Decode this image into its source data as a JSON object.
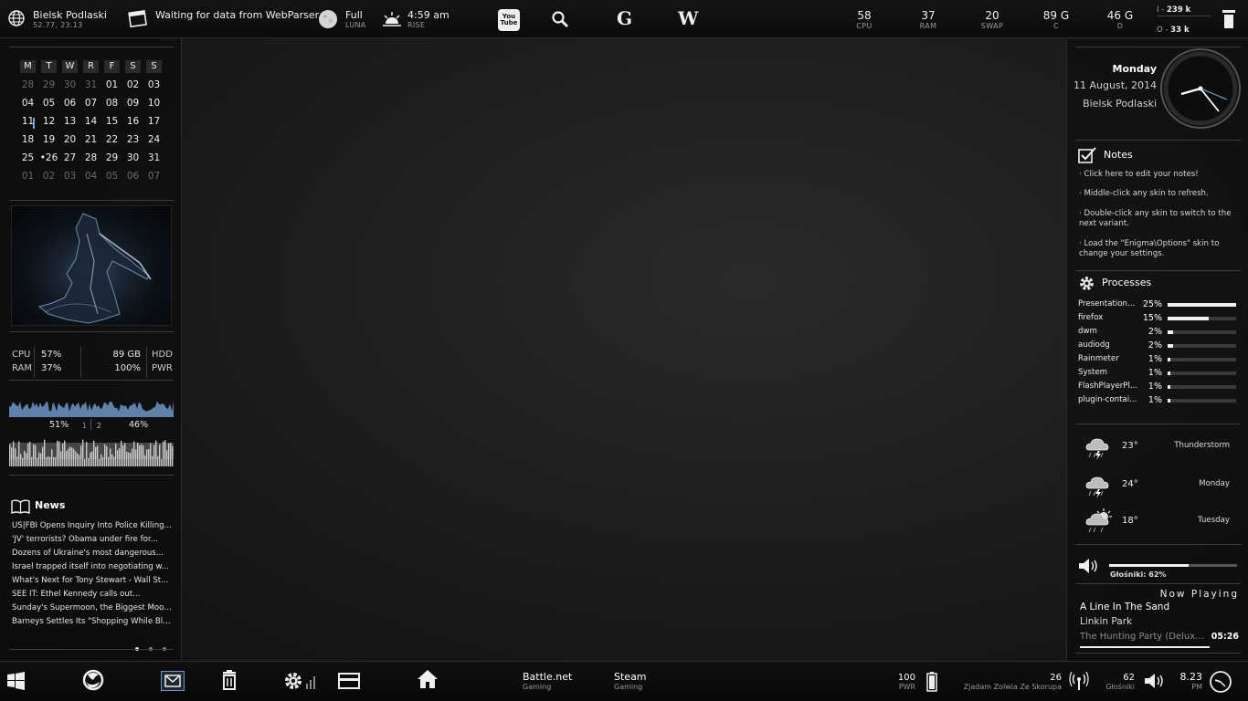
{
  "topbar": {
    "location": {
      "name": "Bielsk Podlaski",
      "coords": "52.77, 23.13"
    },
    "webparser": "Waiting for data from WebParser.",
    "moon": {
      "phase": "Full",
      "label": "LUNA"
    },
    "sunrise": {
      "time": "4:59 am",
      "label": "RISE"
    },
    "links": {
      "youtube": "You Tube",
      "google": "G",
      "wikipedia": "W"
    },
    "stats": [
      {
        "value": "58",
        "label": "CPU"
      },
      {
        "value": "37",
        "label": "RAM"
      },
      {
        "value": "20",
        "label": "SWAP"
      },
      {
        "value": "89 G",
        "label": "C"
      },
      {
        "value": "46 G",
        "label": "D"
      }
    ],
    "net": {
      "in": "239 k",
      "in_prefix": "I -",
      "out": "33 k",
      "out_prefix": "O -"
    }
  },
  "calendar": {
    "headers": [
      "M",
      "T",
      "W",
      "R",
      "F",
      "S",
      "S"
    ],
    "weeks": [
      [
        {
          "d": "28",
          "dim": true
        },
        {
          "d": "29",
          "dim": true
        },
        {
          "d": "30",
          "dim": true
        },
        {
          "d": "31",
          "dim": true
        },
        {
          "d": "01"
        },
        {
          "d": "02"
        },
        {
          "d": "03"
        }
      ],
      [
        {
          "d": "04"
        },
        {
          "d": "05"
        },
        {
          "d": "06"
        },
        {
          "d": "07"
        },
        {
          "d": "08"
        },
        {
          "d": "09"
        },
        {
          "d": "10"
        }
      ],
      [
        {
          "d": "11",
          "today": true
        },
        {
          "d": "12"
        },
        {
          "d": "13"
        },
        {
          "d": "14"
        },
        {
          "d": "15"
        },
        {
          "d": "16"
        },
        {
          "d": "17"
        }
      ],
      [
        {
          "d": "18"
        },
        {
          "d": "19"
        },
        {
          "d": "20"
        },
        {
          "d": "21"
        },
        {
          "d": "22"
        },
        {
          "d": "23"
        },
        {
          "d": "24"
        }
      ],
      [
        {
          "d": "25"
        },
        {
          "d": "•26"
        },
        {
          "d": "27"
        },
        {
          "d": "28"
        },
        {
          "d": "29"
        },
        {
          "d": "30"
        },
        {
          "d": "31"
        }
      ],
      [
        {
          "d": "01",
          "dim": true
        },
        {
          "d": "02",
          "dim": true
        },
        {
          "d": "03",
          "dim": true
        },
        {
          "d": "04",
          "dim": true
        },
        {
          "d": "05",
          "dim": true
        },
        {
          "d": "06",
          "dim": true
        },
        {
          "d": "07",
          "dim": true
        }
      ]
    ]
  },
  "system": {
    "cpu_label": "CPU",
    "cpu_value": "57%",
    "ram_label": "RAM",
    "ram_value": "37%",
    "hdd_value": "89 GB",
    "hdd_label": "HDD",
    "pwr_value": "100%",
    "pwr_label": "PWR"
  },
  "graphs": {
    "left_pct": "51%",
    "left_num": "1",
    "right_num": "2",
    "right_pct": "46%"
  },
  "news": {
    "title": "News",
    "items": [
      "US|FBI Opens Inquiry Into Police Killing...",
      "'JV' terrorists? Obama under fire for...",
      "Dozens of Ukraine's most dangerous...",
      "Israel trapped itself into negotiating w...",
      "What's Next for Tony Stewart - Wall St...",
      "SEE IT: Ethel Kennedy calls out...",
      "Sunday's Supermoon, the Biggest Moon...",
      "Barneys Settles Its \"Shopping While Bla..."
    ]
  },
  "clock": {
    "day": "Monday",
    "date": "11 August, 2014",
    "city": "Bielsk Podlaski"
  },
  "notes": {
    "title": "Notes",
    "items": [
      "· Click here to edit your notes!",
      "· Middle-click any skin to refresh.",
      "· Double-click any skin to switch to the next variant.",
      "· Load the \"Enigma\\Options\" skin to change your settings."
    ]
  },
  "processes": {
    "title": "Processes",
    "items": [
      {
        "name": "Presentation...",
        "pct": "25%",
        "level": 1.0
      },
      {
        "name": "firefox",
        "pct": "15%",
        "level": 0.6
      },
      {
        "name": "dwm",
        "pct": "2%",
        "level": 0.08
      },
      {
        "name": "audiodg",
        "pct": "2%",
        "level": 0.08
      },
      {
        "name": "Rainmeter",
        "pct": "1%",
        "level": 0.04
      },
      {
        "name": "System",
        "pct": "1%",
        "level": 0.04
      },
      {
        "name": "FlashPlayerPl...",
        "pct": "1%",
        "level": 0.04
      },
      {
        "name": "plugin-contai...",
        "pct": "1%",
        "level": 0.04
      }
    ]
  },
  "weather": [
    {
      "temp": "23°",
      "desc": "Thunderstorm"
    },
    {
      "temp": "24°",
      "desc": "Monday"
    },
    {
      "temp": "18°",
      "desc": "Tuesday"
    }
  ],
  "volume": {
    "label": "Głośniki: 62%",
    "level": 0.62
  },
  "nowplaying": {
    "header": "Now Playing",
    "track": "A Line In The Sand",
    "artist": "Linkin Park",
    "album": "The Hunting Party (Deluxe...",
    "time": "05:26"
  },
  "taskbar": {
    "launchers": [
      {
        "title": "Battle.net",
        "sub": "Gaming"
      },
      {
        "title": "Steam",
        "sub": "Gaming"
      }
    ],
    "power": {
      "value": "100",
      "label": "PWR"
    },
    "wifi": {
      "value": "26",
      "label": "Zjadam Zolwia Ze Skorupa"
    },
    "speaker": {
      "value": "62",
      "label": "Głośniki"
    },
    "clock": {
      "time": "8.23",
      "ampm": "PM"
    }
  },
  "colors": {
    "accent": "#7aa7d8",
    "graph_fill": "#6f95c6",
    "graph_fill2": "#c9c9c9"
  }
}
